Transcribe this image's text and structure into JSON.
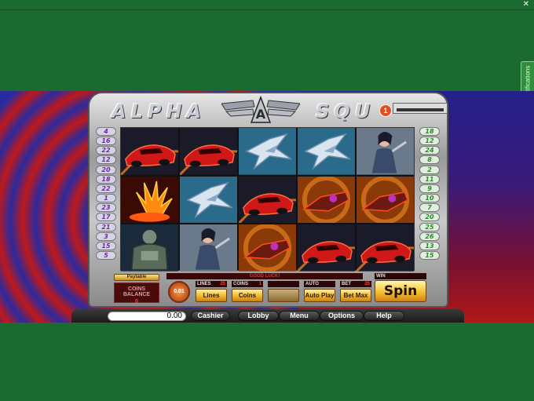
{
  "window": {
    "close_glyph": "✕"
  },
  "notification_tab": {
    "label": "Get Notifications"
  },
  "game": {
    "logo_left": "ALPHA",
    "logo_right": "SQU",
    "emblem_letter": "A",
    "badge_count": "1",
    "lines_left": [
      "4",
      "16",
      "22",
      "12",
      "20",
      "18",
      "22",
      "1",
      "23",
      "17",
      "21",
      "3",
      "15",
      "5"
    ],
    "lines_right": [
      "18",
      "12",
      "24",
      "8",
      "2",
      "11",
      "9",
      "10",
      "7",
      "20",
      "25",
      "26",
      "13",
      "15"
    ],
    "reels": [
      [
        "red-car",
        "fire-burst",
        "armored-hero"
      ],
      [
        "red-car",
        "silver-jet",
        "female-agent"
      ],
      [
        "silver-jet",
        "red-car",
        "hover-bike"
      ],
      [
        "silver-jet",
        "hover-bike",
        "red-car"
      ],
      [
        "female-agent",
        "hover-bike",
        "red-car"
      ]
    ]
  },
  "controls": {
    "paytable_label": "Paytable",
    "coins_balance_label": "COINS BALANCE",
    "coins_balance_value": "0",
    "coin_dial_value": "0.01",
    "message": "GOOD LUCK!",
    "lines_header": "LINES",
    "lines_value": "25",
    "lines_button": "Lines",
    "coins_header": "COINS",
    "coins_value": "1",
    "coins_button": "Coins",
    "auto_header": "AUTO",
    "autoplay_button": "Auto Play",
    "bet_header": "BET",
    "bet_value": "25",
    "betmax_button": "Bet Max",
    "win_header": "WIN",
    "spin_button": "Spin"
  },
  "bottom_bar": {
    "balance": "0.00",
    "cashier": "Cashier",
    "lobby": "Lobby",
    "menu": "Menu",
    "options": "Options",
    "help": "Help"
  },
  "colors": {
    "page_green": "#1b6a30",
    "spin_gold": "#f5c030",
    "line_purple": "#6a2aa0",
    "line_green": "#2a8a2a"
  }
}
